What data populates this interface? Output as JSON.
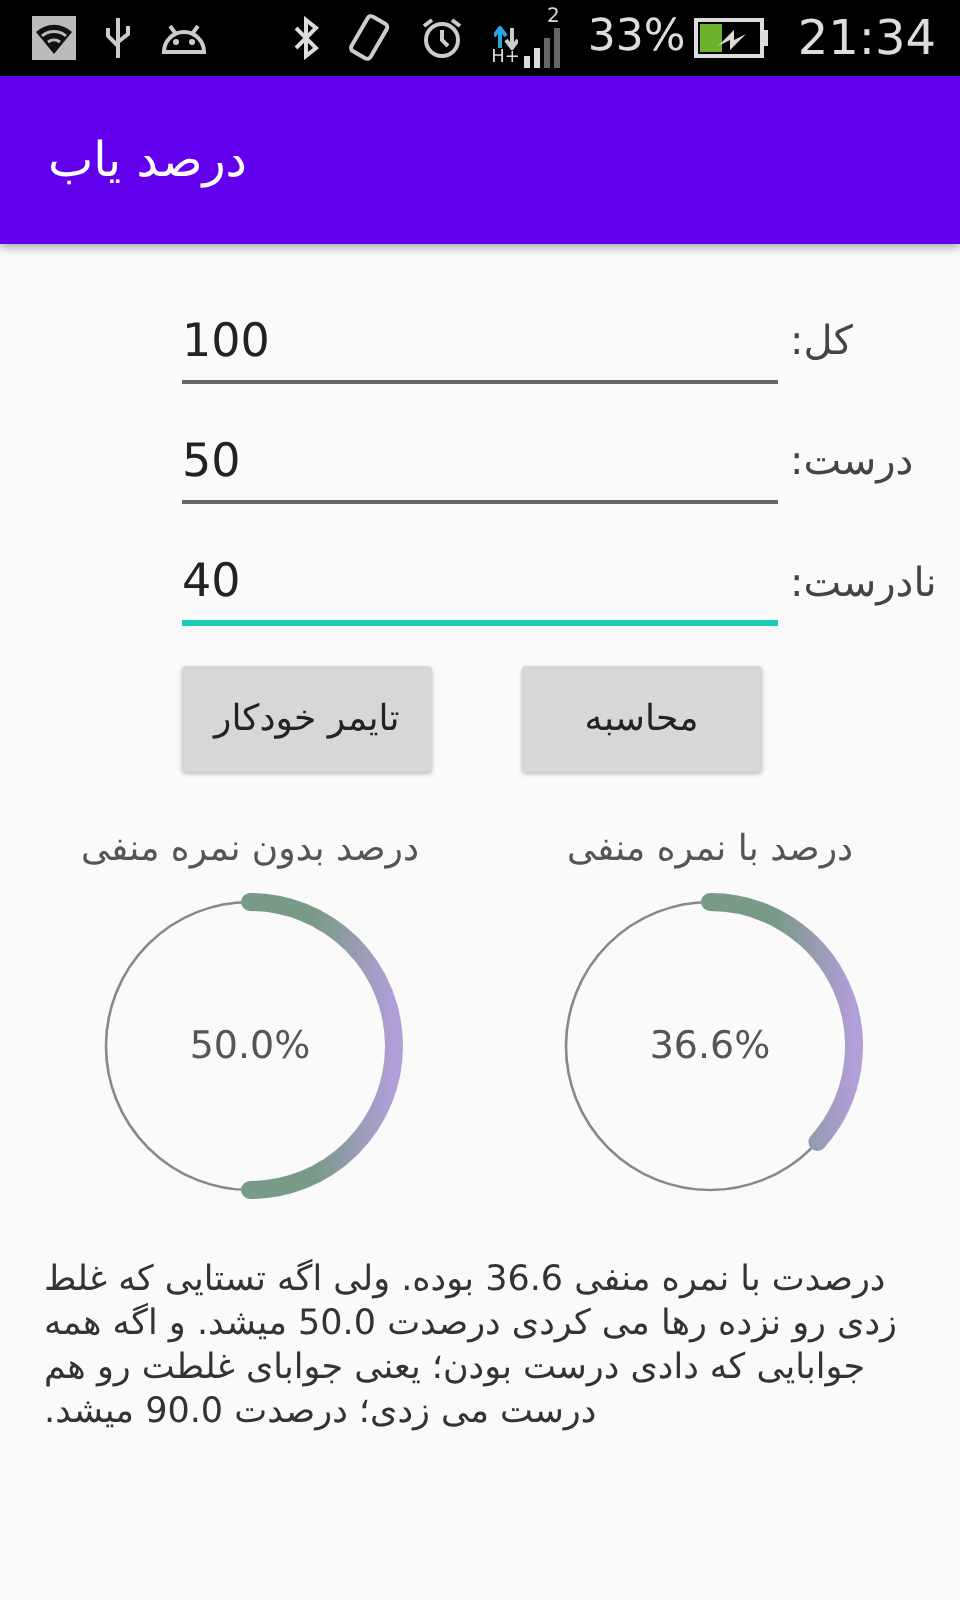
{
  "status_bar": {
    "sim_slot": "2",
    "network_type": "H+",
    "battery": "33%",
    "time": "21:34"
  },
  "app_bar": {
    "title": "درصد یاب"
  },
  "fields": [
    {
      "label": "کل:",
      "value": "100",
      "focused": false
    },
    {
      "label": "درست:",
      "value": "50",
      "focused": false
    },
    {
      "label": "نادرست:",
      "value": "40",
      "focused": true
    }
  ],
  "buttons": [
    {
      "label": "محاسبه"
    },
    {
      "label": "تایمر خودکار"
    }
  ],
  "gauges": [
    {
      "title": "درصد با نمره منفی",
      "reading": "36.6%"
    },
    {
      "title": "درصد بدون نمره منفی",
      "reading": "50.0%"
    }
  ],
  "summary": "درصدت با نمره منفی 36.6 بوده. ولی اگه تستایی که غلط زدی رو نزده رها می کردی درصدت 50.0 میشد. و اگه همه جوابایی که دادی درست بودن؛ یعنی جوابای غلطت رو هم درست می زدی؛ درصدت 90.0 میشد."
}
